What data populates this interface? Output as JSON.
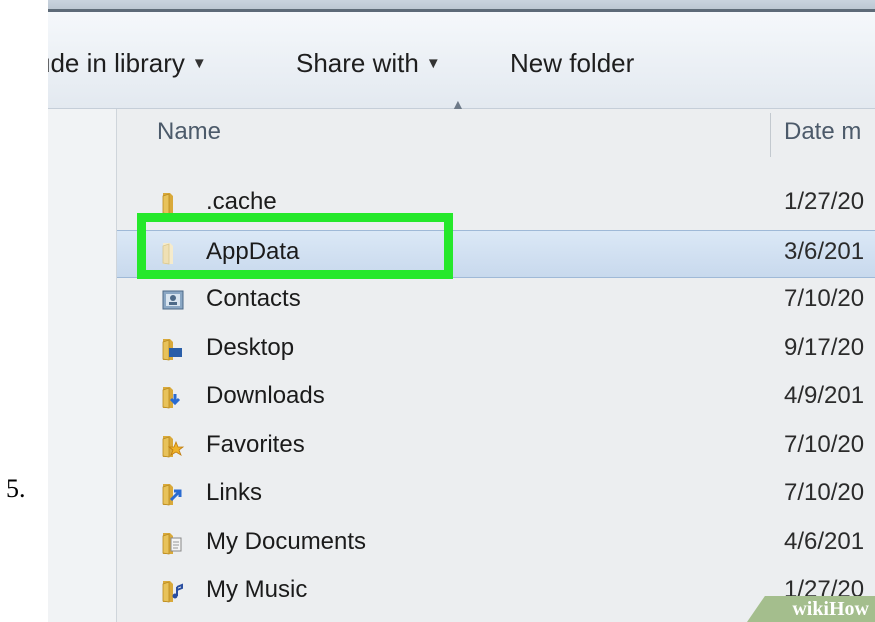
{
  "step_number": "5.",
  "toolbar": {
    "include_label": "ude in library",
    "share_label": "Share with",
    "new_folder_label": "New folder"
  },
  "columns": {
    "name": "Name",
    "date": "Date m"
  },
  "files": [
    {
      "name": ".cache",
      "date": "1/27/20",
      "icon": "folder-icon",
      "selected": false
    },
    {
      "name": "AppData",
      "date": "3/6/201",
      "icon": "folder-faded-icon",
      "selected": true
    },
    {
      "name": "Contacts",
      "date": "7/10/20",
      "icon": "contacts-icon",
      "selected": false
    },
    {
      "name": "Desktop",
      "date": "9/17/20",
      "icon": "desktop-folder-icon",
      "selected": false
    },
    {
      "name": "Downloads",
      "date": "4/9/201",
      "icon": "downloads-folder-icon",
      "selected": false
    },
    {
      "name": "Favorites",
      "date": "7/10/20",
      "icon": "favorites-folder-icon",
      "selected": false
    },
    {
      "name": "Links",
      "date": "7/10/20",
      "icon": "links-folder-icon",
      "selected": false
    },
    {
      "name": "My Documents",
      "date": "4/6/201",
      "icon": "documents-folder-icon",
      "selected": false
    },
    {
      "name": "My Music",
      "date": "1/27/20",
      "icon": "music-folder-icon",
      "selected": false
    }
  ],
  "watermark": {
    "text": "wikiHow"
  },
  "colors": {
    "highlight": "#25e82b",
    "selection": "#c8d9ed",
    "folder": "#e8c25a"
  }
}
